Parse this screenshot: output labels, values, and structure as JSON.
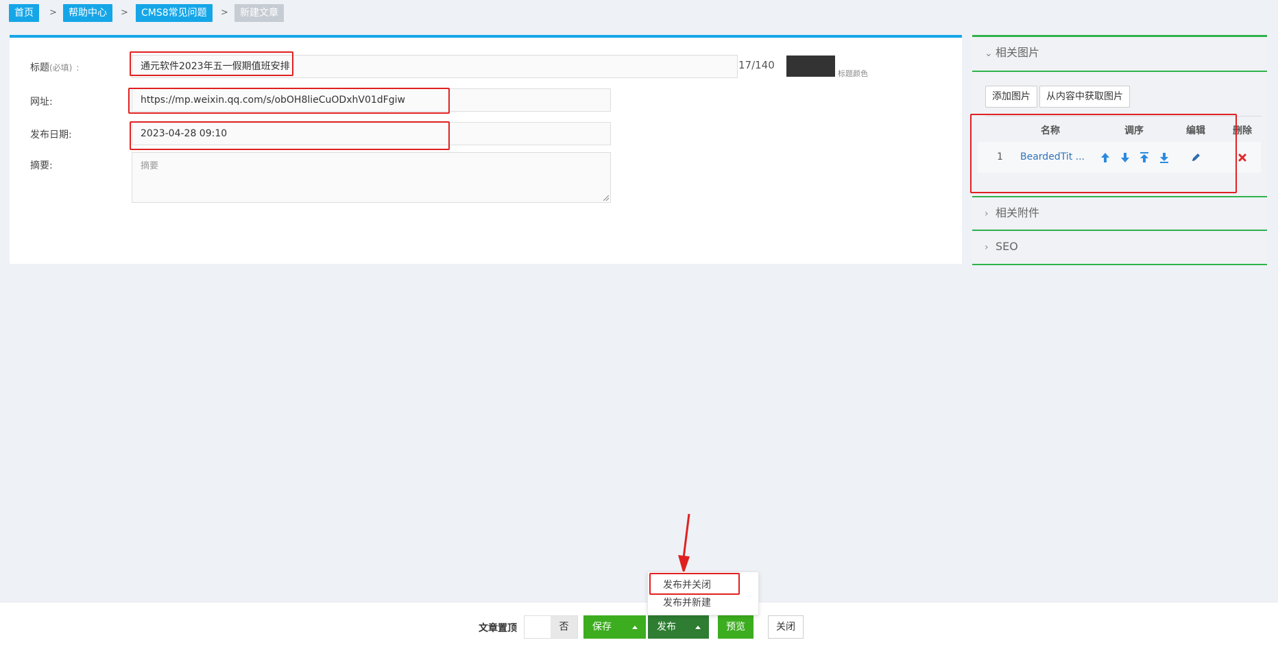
{
  "breadcrumb": {
    "items": [
      "首页",
      "帮助中心",
      "CMS8常见问题",
      "新建文章"
    ],
    "separator": ">"
  },
  "form": {
    "title_label": "标题",
    "title_required": "(必填)",
    "title_colon": ":",
    "title_value": "通元软件2023年五一假期值班安排",
    "title_counter": "17/140",
    "title_color_label": "标题颜色",
    "title_color_value": "#333333",
    "url_label": "网址:",
    "url_value": "https://mp.weixin.qq.com/s/obOH8lieCuODxhV01dFgiw",
    "date_label": "发布日期:",
    "date_value": "2023-04-28 09:10",
    "summary_label": "摘要:",
    "summary_placeholder": "摘要"
  },
  "side": {
    "images_section": "相关图片",
    "add_image": "添加图片",
    "get_from_content": "从内容中获取图片",
    "columns": {
      "name": "名称",
      "order": "调序",
      "edit": "编辑",
      "delete": "删除"
    },
    "rows": [
      {
        "index": "1",
        "name": "BeardedTit ..."
      }
    ],
    "attachments_section": "相关附件",
    "seo_section": "SEO"
  },
  "footer": {
    "pin_label": "文章置顶",
    "pin_value": "否",
    "save": "保存",
    "publish": "发布",
    "preview": "预览",
    "close": "关闭"
  },
  "publish_menu": {
    "items": [
      "发布并关闭",
      "发布并新建"
    ]
  },
  "colors": {
    "accent_blue": "#15a6e8",
    "green": "#3cad1f",
    "dark_green": "#2e7d32",
    "annotation_red": "#e02020"
  }
}
